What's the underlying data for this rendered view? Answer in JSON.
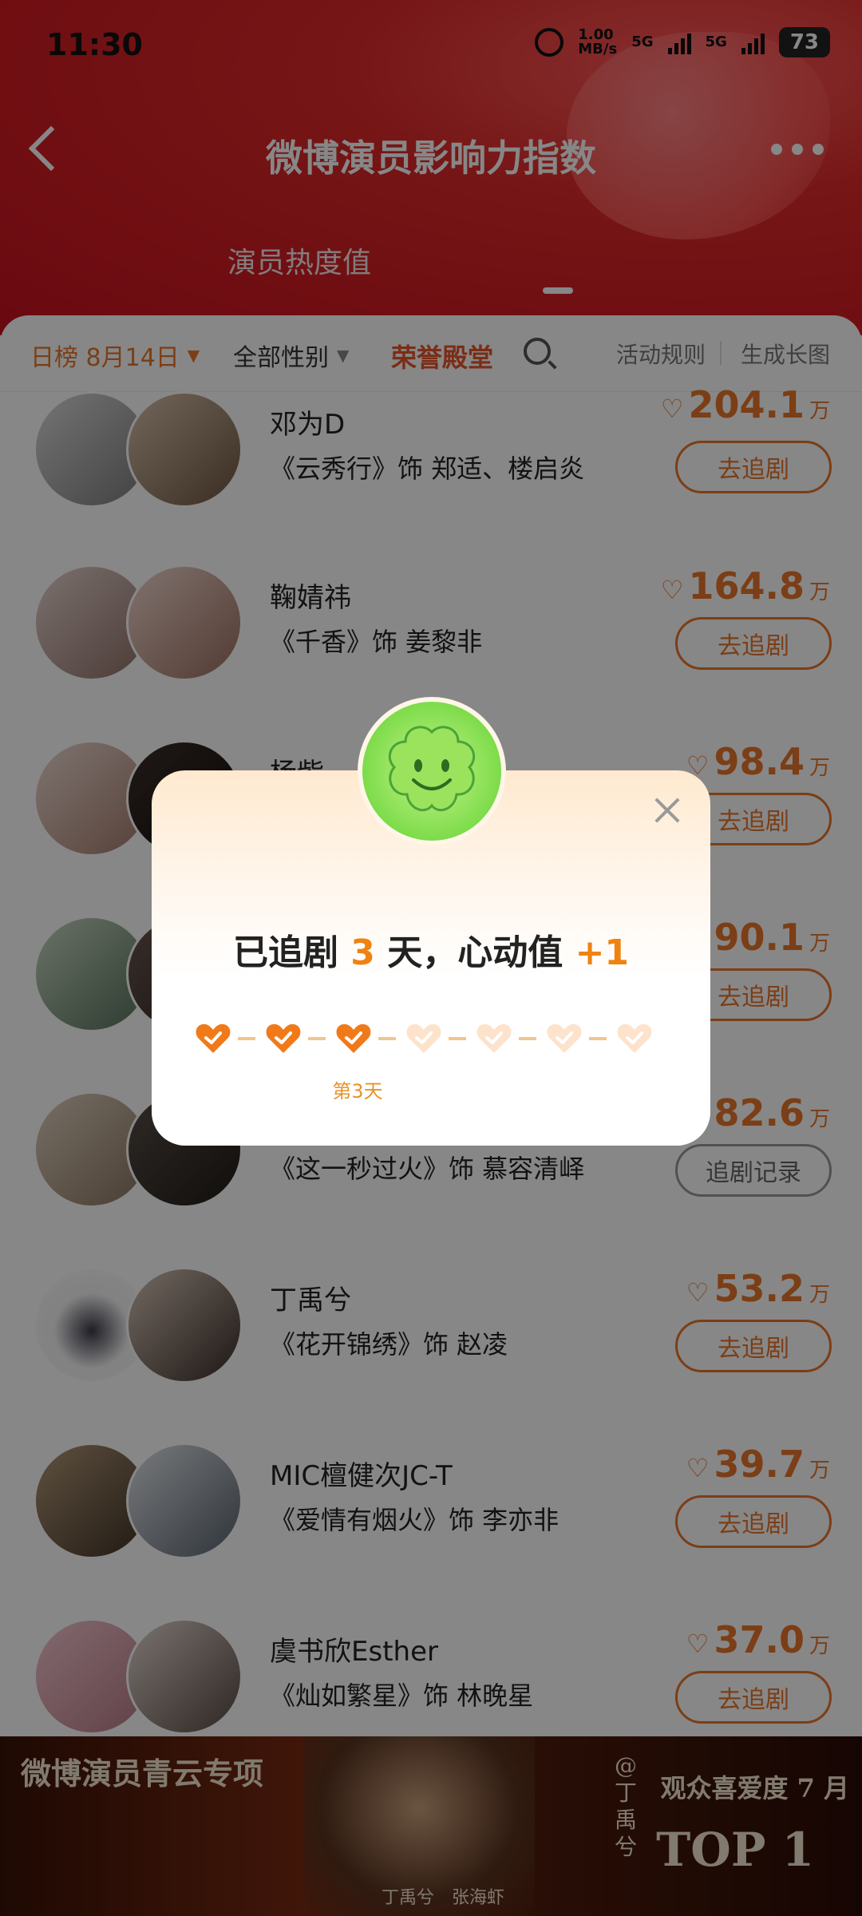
{
  "status_bar": {
    "time": "11:30",
    "net_speed": "1.00",
    "net_unit": "MB/s",
    "sim1": "5G",
    "sim2": "5G",
    "battery": "73"
  },
  "nav": {
    "title": "微博演员影响力指数",
    "back_icon": "chevron-left-icon",
    "more_icon": "more-dots-icon"
  },
  "tabs": [
    {
      "label": "演员热度值",
      "active": false
    },
    {
      "label": "",
      "active": true
    }
  ],
  "filters": {
    "date": "日榜 8月14日",
    "gender": "全部性别",
    "hall": "荣誉殿堂",
    "rules": "活动规则",
    "long_image": "生成长图"
  },
  "list": [
    {
      "name": "邓为D",
      "role": "《云秀行》饰 郑适、楼启炎",
      "score": "204.1",
      "unit": "万",
      "button": "去追剧"
    },
    {
      "name": "鞠婧祎",
      "role": "《千香》饰 姜黎非",
      "score": "164.8",
      "unit": "万",
      "button": "去追剧"
    },
    {
      "name": "杨紫",
      "role": "",
      "score": "98.4",
      "unit": "万",
      "button": "去追剧"
    },
    {
      "name": "",
      "role": "",
      "score": "90.1",
      "unit": "万",
      "button": "去追剧"
    },
    {
      "name": "",
      "role": "《这一秒过火》饰 慕容清峄",
      "score": "82.6",
      "unit": "万",
      "button": "追剧记录"
    },
    {
      "name": "丁禹兮",
      "role": "《花开锦绣》饰 赵凌",
      "score": "53.2",
      "unit": "万",
      "button": "去追剧"
    },
    {
      "name": "MIC檀健次JC-T",
      "role": "《爱情有烟火》饰 李亦非",
      "score": "39.7",
      "unit": "万",
      "button": "去追剧"
    },
    {
      "name": "虞书欣Esther",
      "role": "《灿如繁星》饰 林晚星",
      "score": "37.0",
      "unit": "万",
      "button": "去追剧"
    }
  ],
  "banner": {
    "title": "微博演员青云专项",
    "names": "丁禹兮　张海虾",
    "vertical": "@丁禹兮",
    "fav": "观众喜爱度 7 月",
    "top": "TOP 1"
  },
  "modal": {
    "text_prefix": "已追剧",
    "days": "3",
    "text_mid": "天，心动值",
    "bonus": "+1",
    "day_label": "第3天",
    "checked_days": 3,
    "total_days": 7,
    "colors": {
      "checked": "#f07a1a",
      "unchecked": "#fde3cc"
    }
  }
}
